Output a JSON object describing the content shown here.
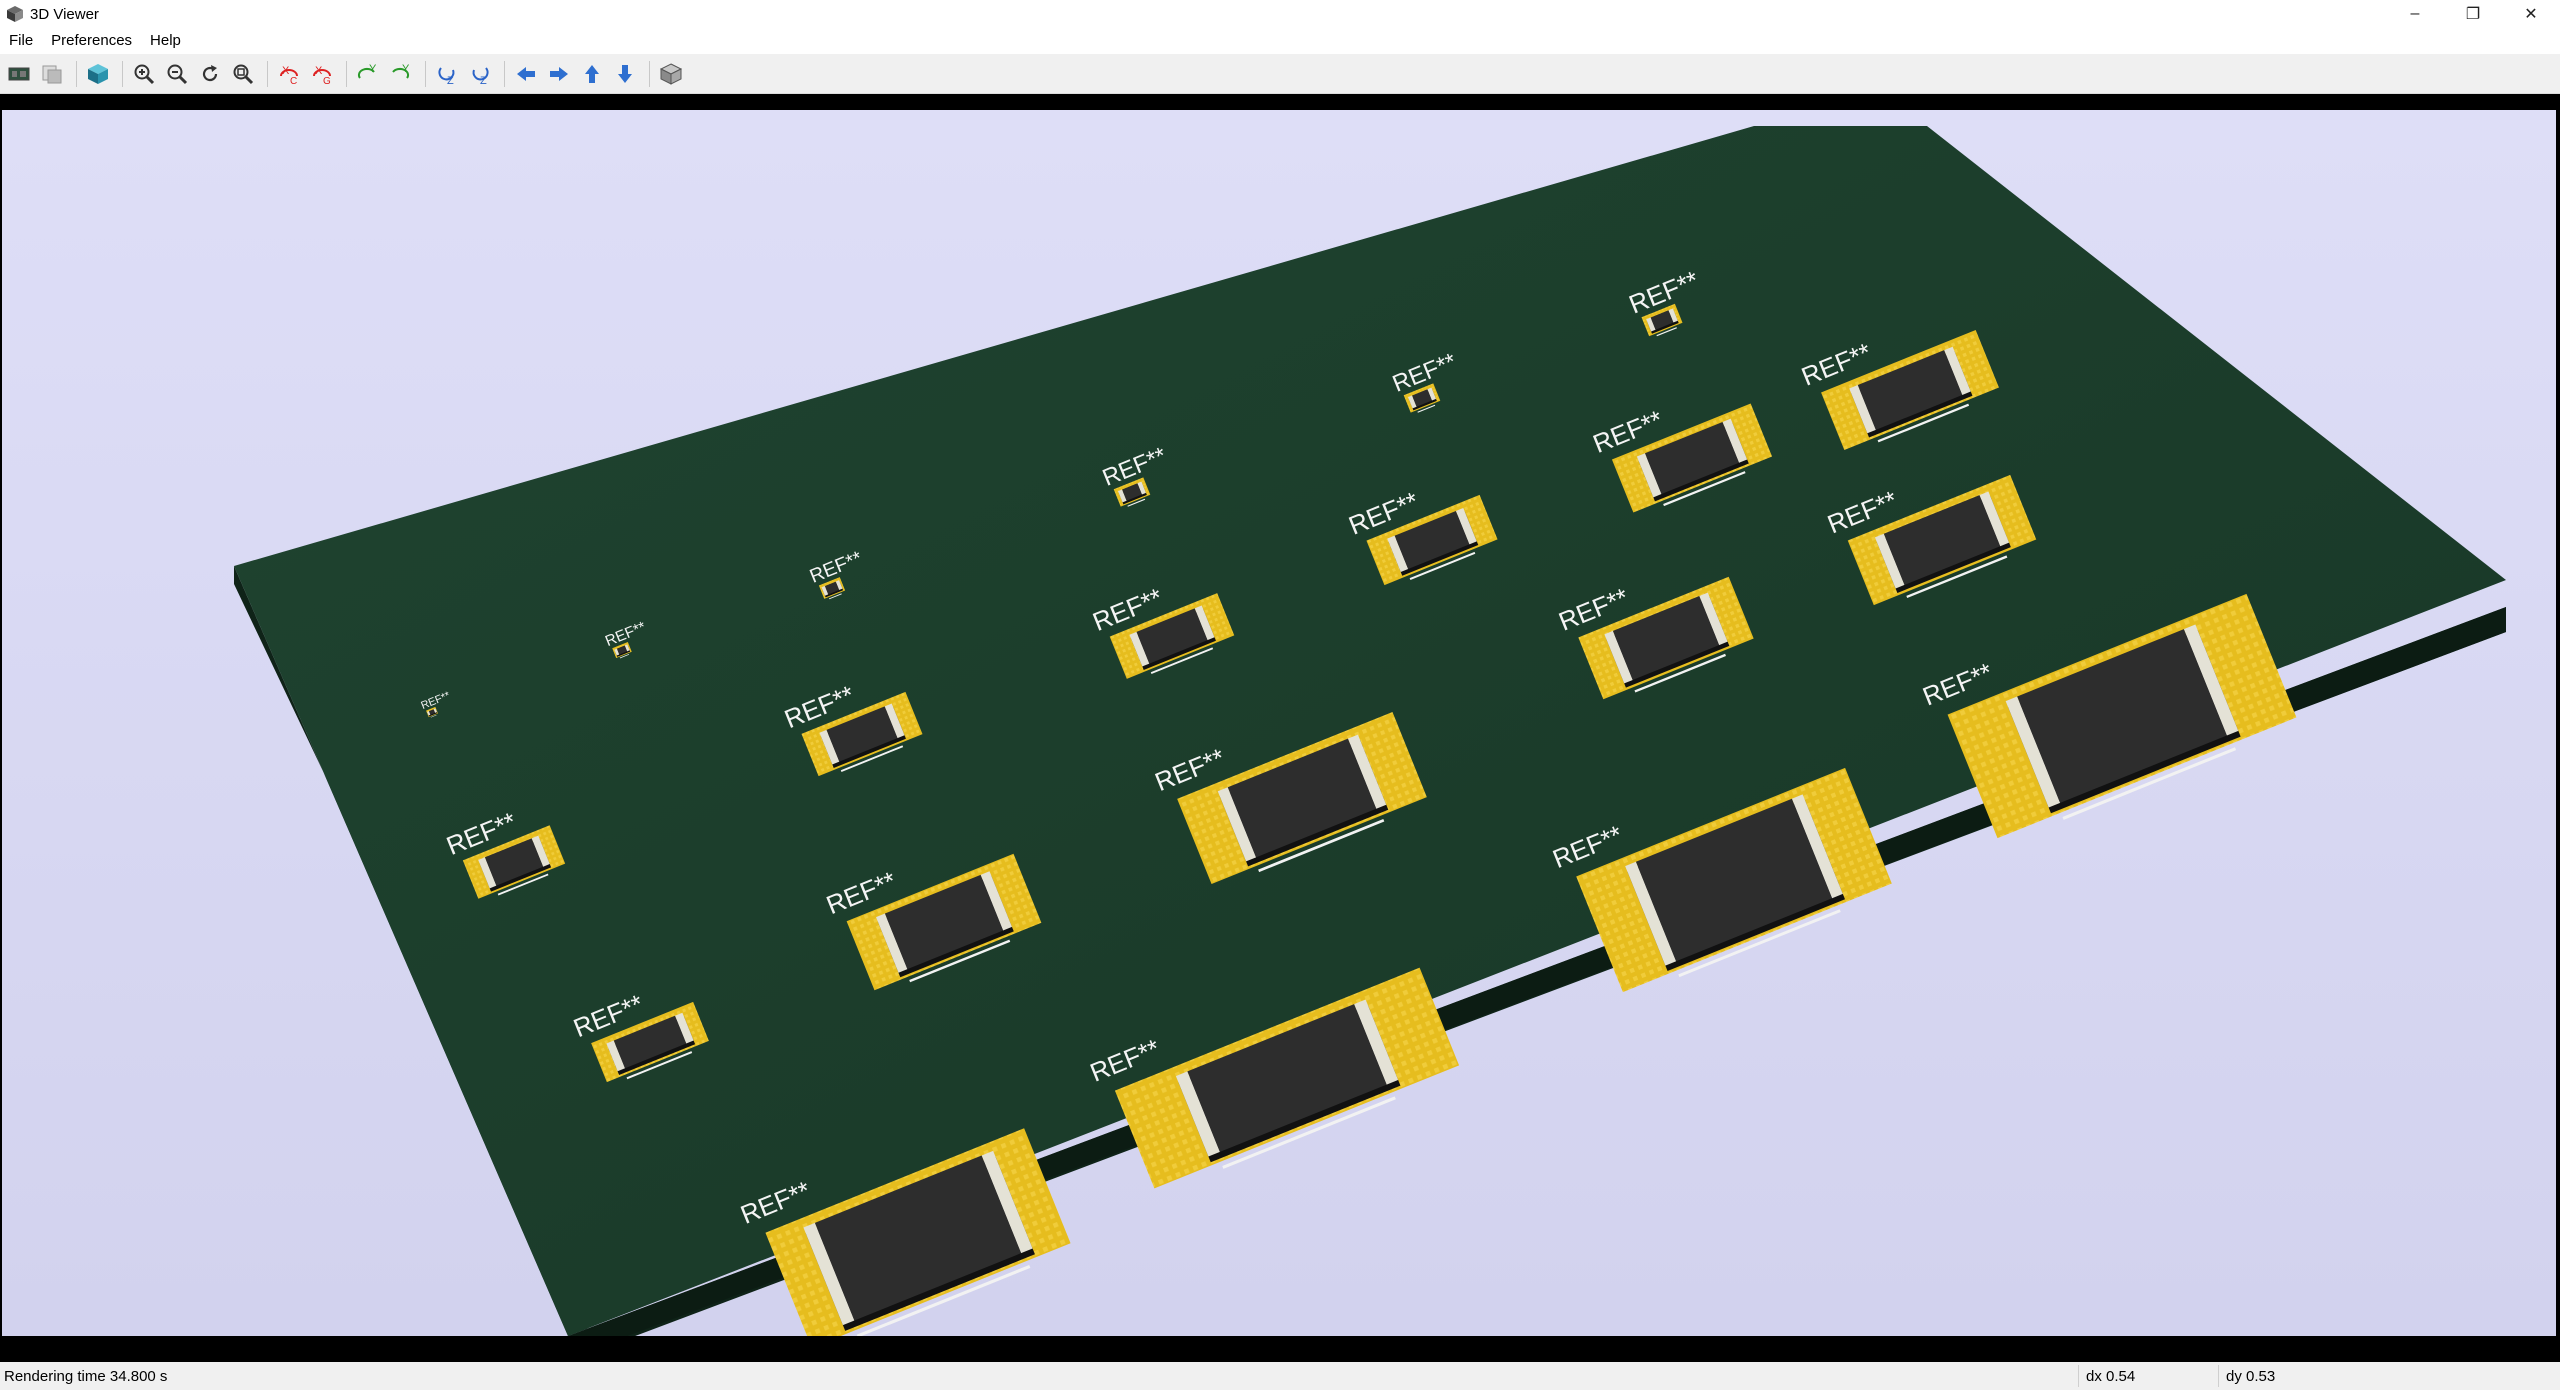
{
  "window": {
    "title": "3D Viewer",
    "controls": {
      "minimize": "–",
      "restore": "❐",
      "close": "✕"
    }
  },
  "menu": [
    "File",
    "Preferences",
    "Help"
  ],
  "toolbar": {
    "buttons": [
      "render-icon",
      "copy-image-icon",
      "raytrace-cube-icon",
      "zoom-in-icon",
      "zoom-out-icon",
      "redraw-icon",
      "zoom-fit-icon",
      "rotate-x-cw-icon",
      "rotate-x-ccw-icon",
      "rotate-y-cw-icon",
      "rotate-y-ccw-icon",
      "rotate-z-cw-icon",
      "rotate-z-ccw-icon",
      "move-left-icon",
      "move-right-icon",
      "move-up-icon",
      "move-down-icon",
      "ortho-cube-icon"
    ]
  },
  "scene": {
    "background_color": "#dcdcf4",
    "board_color": "#1b3f2c",
    "pad_color": "#e8c020",
    "body_color": "#2d2d2d",
    "reference_label": "REF**"
  },
  "status": {
    "render_time": "Rendering time 34.800 s",
    "dx": "dx 0.54",
    "dy": "dy 0.53"
  }
}
